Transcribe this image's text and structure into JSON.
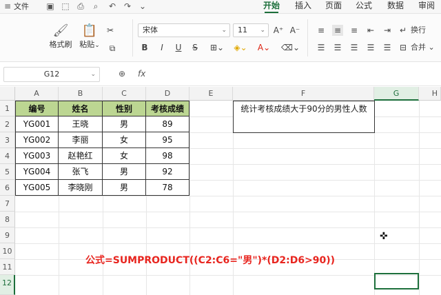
{
  "menubar": {
    "file_label": "文件",
    "tabs": [
      "开始",
      "插入",
      "页面",
      "公式",
      "数据",
      "审阅"
    ],
    "active_tab": "开始"
  },
  "ribbon": {
    "format_painter_label": "格式刷",
    "paste_label": "粘贴",
    "font_name": "宋体",
    "font_size": "11",
    "wrap_label": "换行",
    "merge_label": "合并"
  },
  "formula_bar": {
    "name_box": "G12",
    "fx_symbol": "fx",
    "formula": ""
  },
  "columns": [
    "A",
    "B",
    "C",
    "D",
    "E",
    "F",
    "G",
    "H"
  ],
  "rows": [
    "1",
    "2",
    "3",
    "4",
    "5",
    "6",
    "7",
    "8",
    "9",
    "10",
    "11",
    "12"
  ],
  "table": {
    "headers": [
      "编号",
      "姓名",
      "性别",
      "考核成绩"
    ],
    "rows": [
      [
        "YG001",
        "王晓",
        "男",
        "89"
      ],
      [
        "YG002",
        "李丽",
        "女",
        "95"
      ],
      [
        "YG003",
        "赵艳红",
        "女",
        "98"
      ],
      [
        "YG004",
        "张飞",
        "男",
        "92"
      ],
      [
        "YG005",
        "李晓刚",
        "男",
        "78"
      ]
    ]
  },
  "question": {
    "text": "统计考核成绩大于90分的男性人数",
    "answer": ""
  },
  "note": "公式=SUMPRODUCT((C2:C6=\"男\")*(D2:D6>90))",
  "colors": {
    "accent": "#1c6f3b",
    "header_fill": "#bcd692",
    "note_red": "#e8251f"
  }
}
